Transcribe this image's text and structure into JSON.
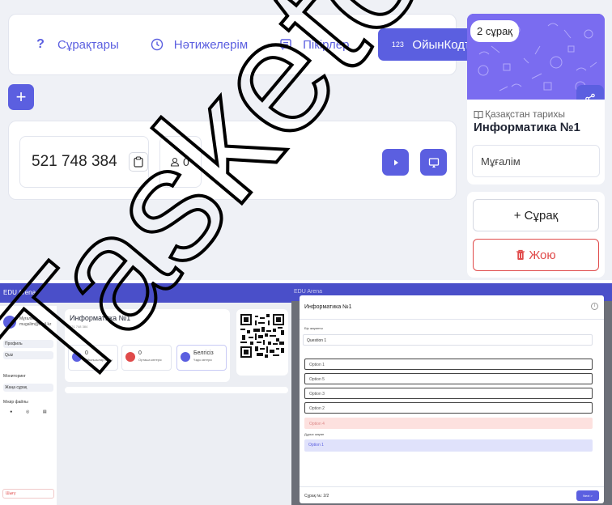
{
  "tabs": [
    {
      "label": "Сұрақтары",
      "icon": "question-icon"
    },
    {
      "label": "Нәтижелерім",
      "icon": "clock-icon"
    },
    {
      "label": "Пікірлер",
      "icon": "comment-icon"
    },
    {
      "label": "ОйынКодтары",
      "icon": "numbers-icon",
      "icon_text": "123",
      "active": true
    }
  ],
  "game": {
    "code": "521 748 384",
    "players": "0"
  },
  "quiz": {
    "questions_badge": "2 сұрақ",
    "subject": "Қазақстан тарихы",
    "title": "Информатика №1",
    "author": "Мұғалім"
  },
  "actions": {
    "add_question": "+ Сұрақ",
    "delete": "Жою"
  },
  "screenshot_left": {
    "app_title": "EDU Arena",
    "user_name": "Мұғалім",
    "user_email": "mugalim@mail.kz",
    "nav": [
      "Профиль",
      "Quiz",
      "Мониторинг",
      "Жаңа сұрақ",
      "Мәзір файлы"
    ],
    "exit": "Шығу",
    "quiz_title": "Информатика №1",
    "quiz_code": "521 748 384",
    "stats": [
      {
        "value": "0",
        "label": "Ойыншылар саны",
        "color": "#5b5fe0"
      },
      {
        "value": "0",
        "label": "Орташа көтеріс",
        "color": "#e04b4b"
      },
      {
        "value": "Белгісіз",
        "label": "Үздік көтеріс",
        "color": "#5b5fe0"
      }
    ]
  },
  "screenshot_right": {
    "app_title": "EDU Arena",
    "modal_title": "Информатика №1",
    "info_icon": "i",
    "question_label": "Бір жауапты",
    "question_text": "Question 1",
    "options": [
      "Option 1",
      "Option 5",
      "Option 3",
      "Option 2",
      "Option 4"
    ],
    "wrong_option_index": 4,
    "answer_label": "Дұрыс жауап",
    "answer_value": "Option 1",
    "counter": "Сұрақ №: 2/2",
    "next": "Next >"
  },
  "watermark": "Tasketov Unt",
  "colors": {
    "accent": "#5b5fe0",
    "danger": "#e04b4b",
    "panel_bg": "#eff1f6"
  }
}
